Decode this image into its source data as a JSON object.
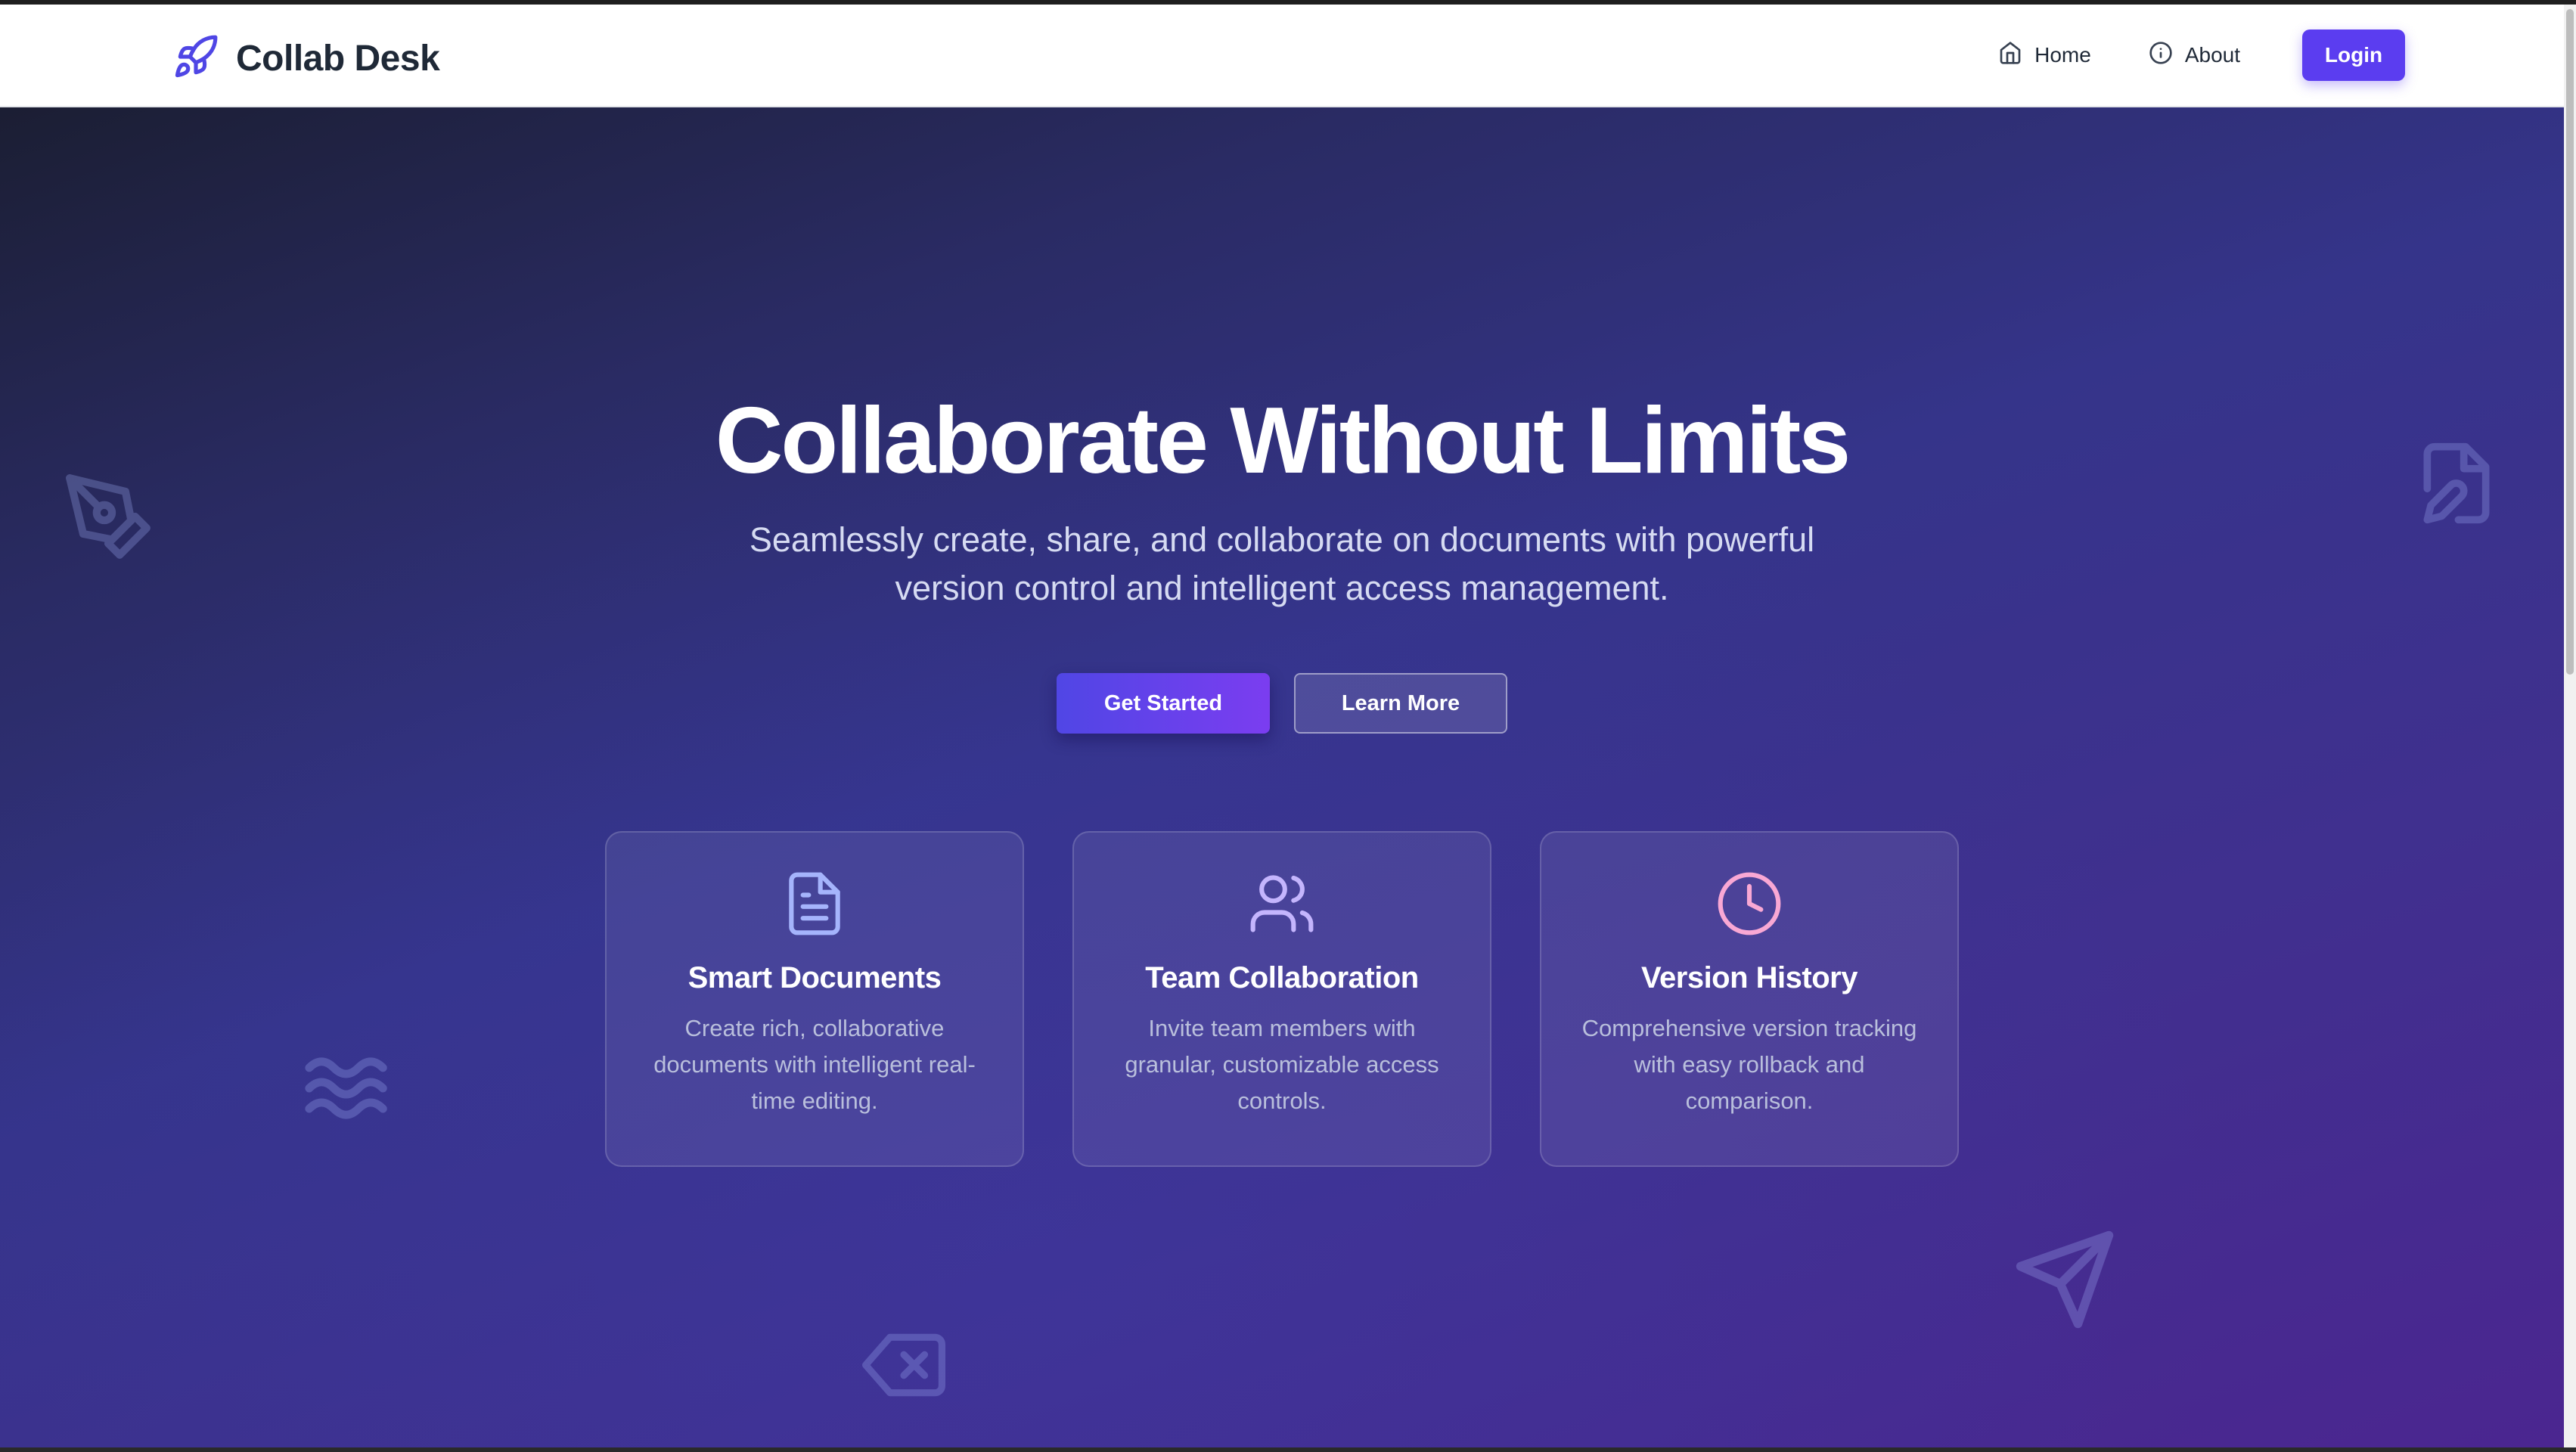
{
  "nav": {
    "brand": "Collab Desk",
    "brand_icon": "rocket-icon",
    "links": [
      {
        "label": "Home",
        "icon": "home-icon"
      },
      {
        "label": "About",
        "icon": "info-icon"
      }
    ],
    "login_label": "Login"
  },
  "hero": {
    "title": "Collaborate Without Limits",
    "subtitle": "Seamlessly create, share, and collaborate on documents with powerful version control and intelligent access management.",
    "primary_cta": "Get Started",
    "secondary_cta": "Learn More"
  },
  "features": [
    {
      "icon": "document-icon",
      "title": "Smart Documents",
      "description": "Create rich, collaborative documents with intelligent real-time editing."
    },
    {
      "icon": "users-icon",
      "title": "Team Collaboration",
      "description": "Invite team members with granular, customizable access controls."
    },
    {
      "icon": "clock-icon",
      "title": "Version History",
      "description": "Comprehensive version tracking with easy rollback and comparison."
    }
  ],
  "colors": {
    "accent": "#5b3df0",
    "hero_gradient_start": "#1b1e33",
    "hero_gradient_end": "#4b2690",
    "feature_icon_doc": "#a5b4fc",
    "feature_icon_users": "#c4b5fd",
    "feature_icon_clock": "#f9a8d4"
  }
}
